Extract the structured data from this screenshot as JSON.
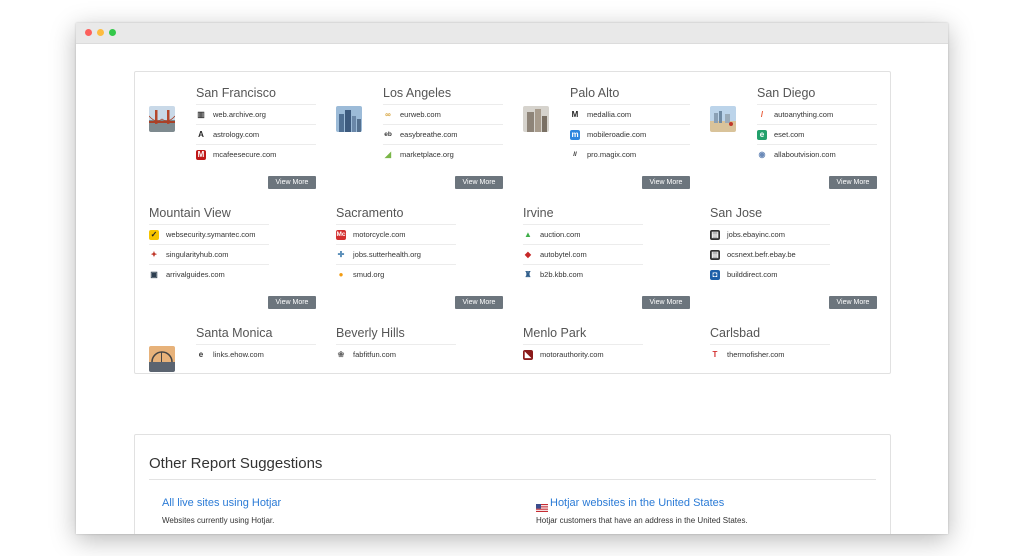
{
  "cities": [
    {
      "name": "San Francisco",
      "has_photo": true,
      "photo": "golden-gate",
      "sites": [
        {
          "label": "web.archive.org",
          "icon": "archive-icon"
        },
        {
          "label": "astrology.com",
          "icon": "astrology-icon"
        },
        {
          "label": "mcafeesecure.com",
          "icon": "mcafee-icon"
        }
      ],
      "view_more": "View More"
    },
    {
      "name": "Los Angeles",
      "has_photo": true,
      "photo": "la-skyline",
      "sites": [
        {
          "label": "eurweb.com",
          "icon": "eurweb-icon"
        },
        {
          "label": "easybreathe.com",
          "icon": "easybreathe-icon"
        },
        {
          "label": "marketplace.org",
          "icon": "marketplace-icon"
        }
      ],
      "view_more": "View More"
    },
    {
      "name": "Palo Alto",
      "has_photo": true,
      "photo": "palo-alto",
      "sites": [
        {
          "label": "medallia.com",
          "icon": "medallia-icon"
        },
        {
          "label": "mobileroadie.com",
          "icon": "mobileroadie-icon"
        },
        {
          "label": "pro.magix.com",
          "icon": "magix-icon"
        }
      ],
      "view_more": "View More"
    },
    {
      "name": "San Diego",
      "has_photo": true,
      "photo": "san-diego",
      "sites": [
        {
          "label": "autoanything.com",
          "icon": "autoanything-icon"
        },
        {
          "label": "eset.com",
          "icon": "eset-icon"
        },
        {
          "label": "allaboutvision.com",
          "icon": "allaboutvision-icon"
        }
      ],
      "view_more": "View More"
    },
    {
      "name": "Mountain View",
      "has_photo": false,
      "sites": [
        {
          "label": "websecurity.symantec.com",
          "icon": "symantec-icon"
        },
        {
          "label": "singularityhub.com",
          "icon": "singularityhub-icon"
        },
        {
          "label": "arrivalguides.com",
          "icon": "arrivalguides-icon"
        }
      ],
      "view_more": "View More"
    },
    {
      "name": "Sacramento",
      "has_photo": false,
      "sites": [
        {
          "label": "motorcycle.com",
          "icon": "motorcycle-icon"
        },
        {
          "label": "jobs.sutterhealth.org",
          "icon": "sutterhealth-icon"
        },
        {
          "label": "smud.org",
          "icon": "smud-icon"
        }
      ],
      "view_more": "View More"
    },
    {
      "name": "Irvine",
      "has_photo": false,
      "sites": [
        {
          "label": "auction.com",
          "icon": "auction-icon"
        },
        {
          "label": "autobytel.com",
          "icon": "autobytel-icon"
        },
        {
          "label": "b2b.kbb.com",
          "icon": "kbb-icon"
        }
      ],
      "view_more": "View More"
    },
    {
      "name": "San Jose",
      "has_photo": false,
      "sites": [
        {
          "label": "jobs.ebayinc.com",
          "icon": "ebay-jobs-icon"
        },
        {
          "label": "ocsnext.befr.ebay.be",
          "icon": "ebay-be-icon"
        },
        {
          "label": "builddirect.com",
          "icon": "builddirect-icon"
        }
      ],
      "view_more": "View More"
    },
    {
      "name": "Santa Monica",
      "has_photo": true,
      "photo": "santa-monica",
      "sites": [
        {
          "label": "links.ehow.com",
          "icon": "ehow-icon"
        }
      ]
    },
    {
      "name": "Beverly Hills",
      "has_photo": false,
      "sites": [
        {
          "label": "fabfitfun.com",
          "icon": "fabfitfun-icon"
        }
      ]
    },
    {
      "name": "Menlo Park",
      "has_photo": false,
      "sites": [
        {
          "label": "motorauthority.com",
          "icon": "motorauthority-icon"
        }
      ]
    },
    {
      "name": "Carlsbad",
      "has_photo": false,
      "sites": [
        {
          "label": "thermofisher.com",
          "icon": "thermofisher-icon"
        }
      ]
    }
  ],
  "suggestions": {
    "heading": "Other Report Suggestions",
    "items": [
      {
        "title": "All live sites using Hotjar",
        "desc": "Websites currently using Hotjar.",
        "flag": false
      },
      {
        "title": "Hotjar websites in the United States",
        "desc": "Hotjar customers that have an address in the United States.",
        "flag": true
      }
    ]
  },
  "colors": {
    "link": "#2b7bd6",
    "button": "#6c757d",
    "border": "#e1e1e1"
  }
}
